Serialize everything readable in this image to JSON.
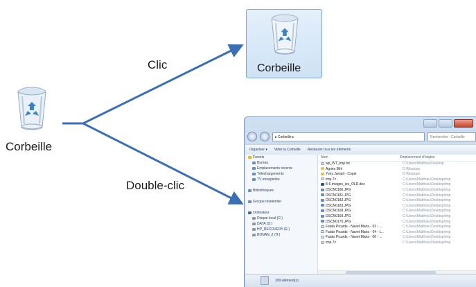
{
  "desktop_icon": {
    "label": "Corbeille"
  },
  "selected_icon": {
    "label": "Corbeille"
  },
  "arrows": {
    "click_label": "Clic",
    "double_click_label": "Double-clic"
  },
  "explorer": {
    "address": "▸ Corbeille ▸",
    "search_placeholder": "Rechercher : Corbeille",
    "toolbar": {
      "organize": "Organiser ▾",
      "empty": "Vider la Corbeille",
      "restore": "Restaurer tous les éléments"
    },
    "columns": {
      "name": "Nom",
      "origin": "Emplacement d'origine"
    },
    "nav": [
      {
        "label": "Favoris",
        "top": true,
        "icon": "star"
      },
      {
        "label": "Bureau",
        "icon": "folder"
      },
      {
        "label": "Emplacements récents",
        "icon": "folder"
      },
      {
        "label": "Téléchargements",
        "icon": "folder"
      },
      {
        "label": "TV enregistrée",
        "icon": "folder"
      },
      {
        "gap": true
      },
      {
        "label": "Bibliothèques",
        "top": true,
        "icon": "folder"
      },
      {
        "gap": true
      },
      {
        "label": "Groupe résidentiel",
        "top": true,
        "icon": "folder"
      },
      {
        "gap": true
      },
      {
        "label": "Ordinateur",
        "top": true,
        "icon": "pc"
      },
      {
        "label": "Disque local (C:)",
        "icon": "drive"
      },
      {
        "label": "DATA (D:)",
        "icon": "drive"
      },
      {
        "label": "HP_RECOVERY (E:)",
        "icon": "drive"
      },
      {
        "label": "BONAN_Z (H:)",
        "icon": "drive"
      }
    ],
    "files": [
      {
        "name": "wp_WT_tmp.txt",
        "type": "txt",
        "origin": "C:\\Users\\Matthieu\\Desktop"
      },
      {
        "name": "Agnès Bihl",
        "type": "folder",
        "origin": "D:\\Musique"
      },
      {
        "name": "Yves Jamait - Copie",
        "type": "folder",
        "origin": "D:\\Musique"
      },
      {
        "name": "tmp.7z",
        "type": "txt",
        "origin": "C:\\Users\\Matthieu\\Desktop\\tmp"
      },
      {
        "name": "8-6-images_ies_OLD.doc",
        "type": "doc",
        "origin": "C:\\Users\\Matthieu\\Desktop\\tmp"
      },
      {
        "name": "DSCN0180.JPG",
        "type": "img",
        "origin": "C:\\Users\\Matthieu\\Desktop\\tmp"
      },
      {
        "name": "DSCN0181.JPG",
        "type": "img",
        "origin": "C:\\Users\\Matthieu\\Desktop\\tmp"
      },
      {
        "name": "DSCN0182.JPG",
        "type": "img",
        "origin": "C:\\Users\\Matthieu\\Desktop\\tmp"
      },
      {
        "name": "DSCN0183.JPG",
        "type": "img",
        "origin": "C:\\Users\\Matthieu\\Desktop\\tmp"
      },
      {
        "name": "DSCN0168.JPG",
        "type": "img",
        "origin": "C:\\Users\\Matthieu\\Desktop\\tmp"
      },
      {
        "name": "DSCN0169.JPG",
        "type": "img",
        "origin": "C:\\Users\\Matthieu\\Desktop\\tmp"
      },
      {
        "name": "DSCN0170.JPG",
        "type": "img",
        "origin": "C:\\Users\\Matthieu\\Desktop\\tmp"
      },
      {
        "name": "Fatals Picards - Navet Maria - 03 - ...",
        "type": "mp3",
        "origin": "C:\\Users\\Matthieu\\Desktop\\tmp"
      },
      {
        "name": "Fatals Picards - Navet Maria - 04 - L...",
        "type": "mp3",
        "origin": "C:\\Users\\Matthieu\\Desktop\\tmp"
      },
      {
        "name": "Fatals Picards - Navet Maria - 06 - ...",
        "type": "mp3",
        "origin": "C:\\Users\\Matthieu\\Desktop\\tmp"
      },
      {
        "name": "tmp.7z",
        "type": "txt",
        "origin": "C:\\Users\\Matthieu\\Desktop\\tmp"
      }
    ],
    "status": "209 élément(s)"
  }
}
